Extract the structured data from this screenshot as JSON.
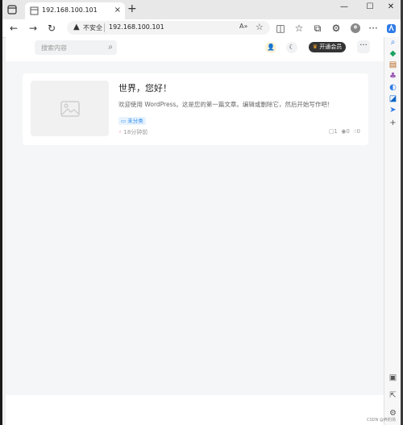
{
  "tab": {
    "title": "192.168.100.101",
    "close": "×",
    "new_tab": "+"
  },
  "window_controls": [
    "—",
    "☐",
    "✕"
  ],
  "address_bar": {
    "insecure_label": "不安全",
    "url": "192.168.100.101",
    "read_aloud": "A»"
  },
  "site": {
    "search_placeholder": "搜索内容",
    "vip_label": "开通会员",
    "more": "···"
  },
  "post": {
    "title": "世界，您好！",
    "excerpt": "欢迎使用 WordPress。这是您的第一篇文章。编辑或删除它，然后开始写作吧！",
    "category": "未分类",
    "time": "18分钟前",
    "comments": "1",
    "views": "0",
    "likes": "0"
  },
  "watermark": "CSDN @养豹场"
}
